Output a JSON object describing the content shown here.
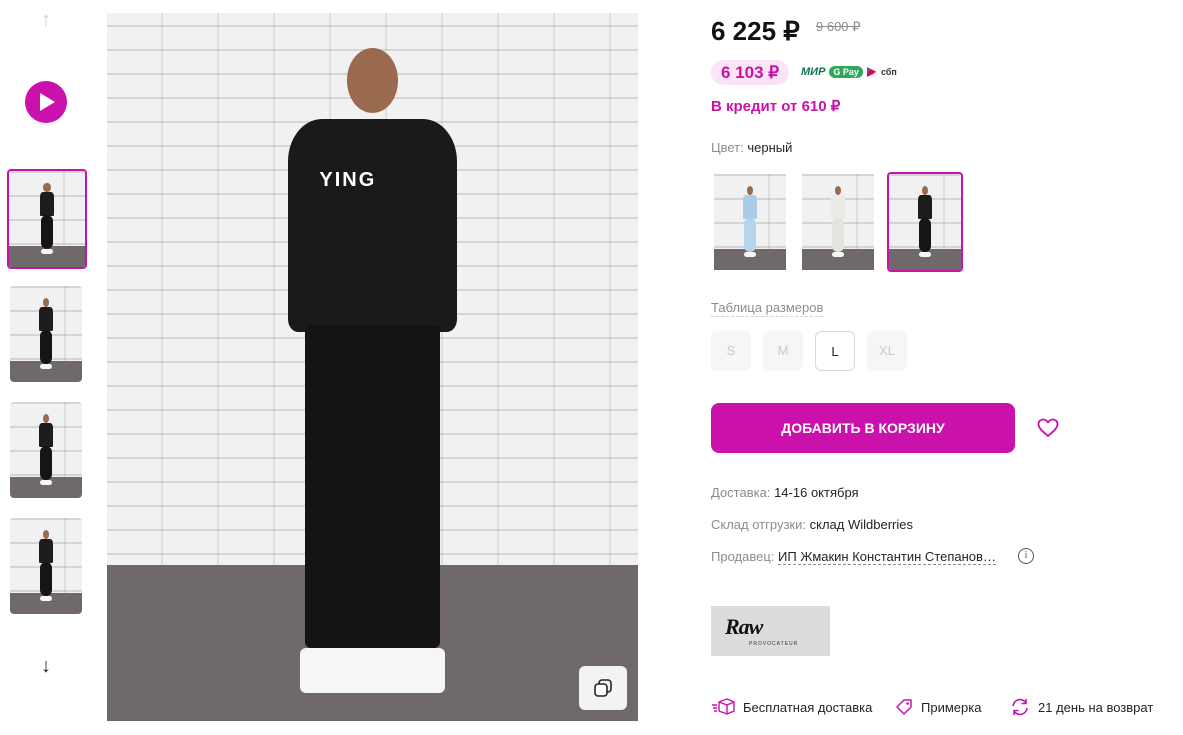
{
  "gallery": {
    "arrow_up_icon": "arrow-up-icon",
    "play_icon": "play-icon",
    "arrow_down_icon": "arrow-down-icon",
    "thumbnails": [
      {
        "active": true
      },
      {
        "active": false
      },
      {
        "active": false
      },
      {
        "active": false
      }
    ],
    "main_image_text": "YING"
  },
  "pricing": {
    "price": "6 225 ₽",
    "old_price": "9 600 ₽",
    "wallet_price": "6 103 ₽",
    "mir": "МИР",
    "pay": "G Pay",
    "sbp": "сбп",
    "credit": "В кредит от 610 ₽"
  },
  "color": {
    "label": "Цвет:",
    "value": "черный",
    "variants": [
      {
        "name": "light-blue",
        "active": false
      },
      {
        "name": "white",
        "active": false
      },
      {
        "name": "black",
        "active": true
      }
    ]
  },
  "sizes": {
    "table_link": "Таблица размеров",
    "items": [
      {
        "label": "S",
        "available": false
      },
      {
        "label": "M",
        "available": false
      },
      {
        "label": "L",
        "available": true
      },
      {
        "label": "XL",
        "available": false
      }
    ]
  },
  "actions": {
    "add_to_cart": "ДОБАВИТЬ В КОРЗИНУ"
  },
  "delivery": {
    "delivery_label": "Доставка:",
    "delivery_value": "14-16 октября",
    "warehouse_label": "Склад отгрузки:",
    "warehouse_value": "склад Wildberries",
    "seller_label": "Продавец:",
    "seller_value": "ИП Жмакин Константин Степанов…",
    "info_glyph": "i"
  },
  "brand": {
    "logo_text": "Raw",
    "logo_sub": "PROVOCATEUR"
  },
  "features": [
    {
      "icon": "box-icon",
      "label": "Бесплатная доставка"
    },
    {
      "icon": "tag-icon",
      "label": "Примерка"
    },
    {
      "icon": "return-icon",
      "label": "21 день на возврат"
    }
  ],
  "colors": {
    "accent": "#cb11ab",
    "wallet_bg": "#fae5f6",
    "muted": "#8c8c8c"
  }
}
